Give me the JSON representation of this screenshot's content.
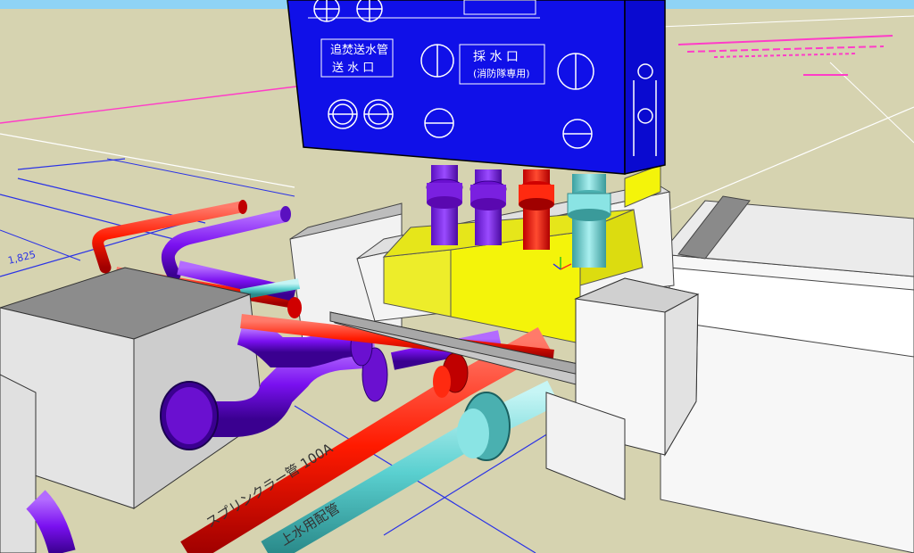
{
  "viewport": {
    "sky_color": "#8fd3f5",
    "ground_color": "#d6d3b0"
  },
  "cabinet": {
    "label_return_pipe_line1": "追焚送水管",
    "label_return_pipe_line2": "送 水 口",
    "label_water_inlet": "採 水 口",
    "label_water_inlet_sub": "(消防隊専用)"
  },
  "plan_annotations": {
    "dimension_text": "1,825",
    "sprinkler_pipe_label": "スプリンクラー管 100A",
    "water_pipe_label": "上水用配管"
  },
  "pipe_colors": {
    "sprinkler": "#ff1a00",
    "return": "#8a1cff",
    "water": "#6ad7d7",
    "sleeve": "#f2f20a",
    "beam": "#c8c8c8"
  },
  "icons": {
    "valve": "gate-valve-icon",
    "axis": "axis-triad-icon"
  }
}
